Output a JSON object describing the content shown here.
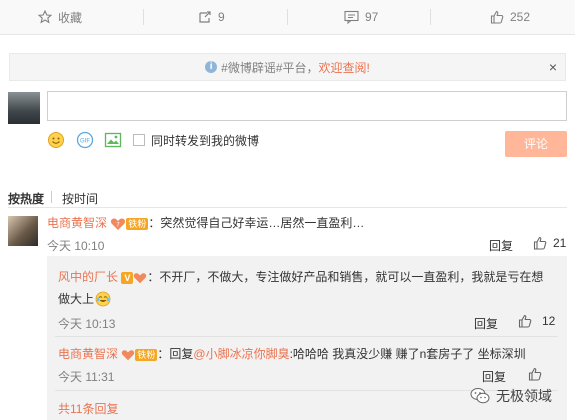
{
  "topbar": {
    "favorite_label": "收藏",
    "forward_count": "9",
    "comment_count": "97",
    "like_count": "252"
  },
  "notice": {
    "prefix": "#微博辟谣#平台，",
    "link": "欢迎查阅!",
    "close": "×"
  },
  "compose": {
    "sync_label": "同时转发到我的微博",
    "submit_label": "评论"
  },
  "sort": {
    "hot": "按热度",
    "time": "按时间"
  },
  "comment": {
    "author": "电商黄智深",
    "badge": "铁粉",
    "text": "：突然觉得自己好幸运…居然一直盈利…",
    "time": "今天 10:10",
    "reply_label": "回复",
    "likes": "21"
  },
  "replies": [
    {
      "author": "风中的厂长",
      "text_line1": "：不开厂，不做大，专注做好产品和销售，就可以一直盈利，我就是亏在想",
      "text_line2": "做大上",
      "time": "今天 10:13",
      "reply_label": "回复",
      "likes": "12"
    },
    {
      "author": "电商黄智深",
      "badge": "铁粉",
      "pre": "：回复",
      "mention": "@小脚冰凉你脚臭",
      "text": ":哈哈哈 我真没少赚 赚了n套房子了 坐标深圳",
      "time": "今天 11:31",
      "reply_label": "回复"
    }
  ],
  "more_replies": "共11条回复",
  "watermark": "无极领域",
  "colors": {
    "accent": "#eb7350",
    "button_disabled": "#ffb699",
    "muted": "#808080"
  }
}
